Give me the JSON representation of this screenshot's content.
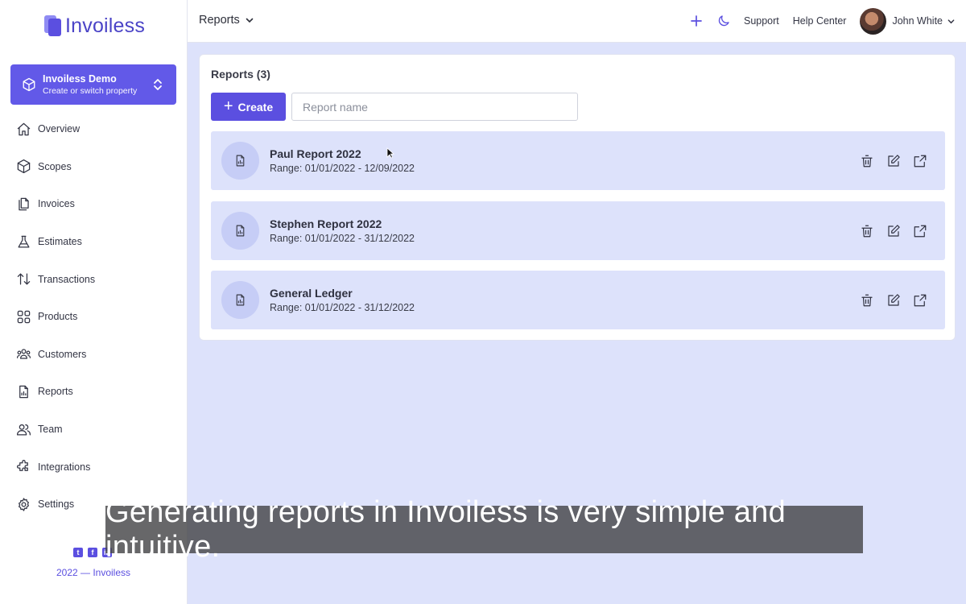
{
  "app": {
    "name": "Invoiless"
  },
  "property": {
    "title": "Invoiless Demo",
    "subtitle": "Create or switch property"
  },
  "nav": [
    {
      "label": "Overview",
      "icon": "home-icon"
    },
    {
      "label": "Scopes",
      "icon": "cube-icon"
    },
    {
      "label": "Invoices",
      "icon": "documents-icon"
    },
    {
      "label": "Estimates",
      "icon": "flask-icon"
    },
    {
      "label": "Transactions",
      "icon": "arrows-updown-icon"
    },
    {
      "label": "Products",
      "icon": "grid-icon"
    },
    {
      "label": "Customers",
      "icon": "users-group-icon"
    },
    {
      "label": "Reports",
      "icon": "report-icon"
    },
    {
      "label": "Team",
      "icon": "team-icon"
    },
    {
      "label": "Integrations",
      "icon": "puzzle-icon"
    },
    {
      "label": "Settings",
      "icon": "gear-icon"
    }
  ],
  "footer": {
    "copyright": "2022 — Invoiless",
    "socials": [
      "twitter-icon",
      "facebook-icon",
      "linkedin-icon"
    ]
  },
  "topbar": {
    "breadcrumb": "Reports",
    "support": "Support",
    "help_center": "Help Center",
    "user_name": "John White"
  },
  "reports": {
    "title": "Reports (3)",
    "create_label": "Create",
    "search_placeholder": "Report name",
    "items": [
      {
        "name": "Paul Report 2022",
        "range": "Range: 01/01/2022 - 12/09/2022"
      },
      {
        "name": "Stephen Report 2022",
        "range": "Range: 01/01/2022 - 31/12/2022"
      },
      {
        "name": "General Ledger",
        "range": "Range: 01/01/2022 - 31/12/2022"
      }
    ]
  },
  "caption": "Generating reports in Invoiless is very simple and intuitive.",
  "colors": {
    "accent": "#5b4fe0",
    "background": "#dde2fb",
    "row": "#dde2fb"
  }
}
